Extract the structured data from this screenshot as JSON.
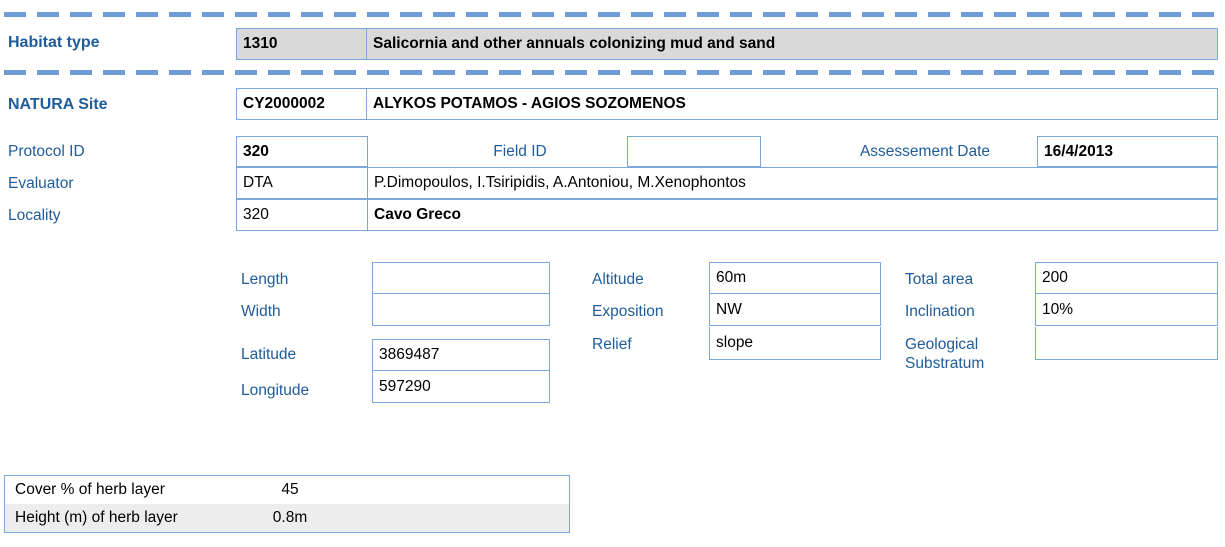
{
  "colors": {
    "accent_blue": "#7ba7d9",
    "label_blue": "#1f5c99",
    "grey_fill": "#d9d9d9",
    "alt_row": "#ededed"
  },
  "habitat": {
    "label": "Habitat type",
    "code": "1310",
    "name": "Salicornia and other annuals colonizing mud and sand"
  },
  "natura": {
    "label": "NATURA Site",
    "code": "CY2000002",
    "name": "ALYKOS POTAMOS - AGIOS SOZOMENOS"
  },
  "protocol": {
    "label": "Protocol ID",
    "value": "320",
    "field_id_label": "Field ID",
    "field_id_value": "",
    "assessment_date_label": "Assessement Date",
    "assessment_date_value": "16/4/2013"
  },
  "evaluator": {
    "label": "Evaluator",
    "code": "DTA",
    "names": "P.Dimopoulos, I.Tsiripidis, A.Antoniou, M.Xenophontos"
  },
  "locality": {
    "label": "Locality",
    "code": "320",
    "name": "Cavo Greco"
  },
  "measurements": {
    "length": {
      "label": "Length",
      "value": ""
    },
    "width": {
      "label": "Width",
      "value": ""
    },
    "latitude": {
      "label": "Latitude",
      "value": "3869487"
    },
    "longitude": {
      "label": "Longitude",
      "value": "597290"
    },
    "altitude": {
      "label": "Altitude",
      "value": "60m"
    },
    "exposition": {
      "label": "Exposition",
      "value": "NW"
    },
    "relief": {
      "label": "Relief",
      "value": "slope"
    },
    "total_area": {
      "label": "Total area",
      "value": "200"
    },
    "inclination": {
      "label": "Inclination",
      "value": "10%"
    },
    "geological_substratum": {
      "label_line1": "Geological",
      "label_line2": "Substratum",
      "value": ""
    }
  },
  "summary": {
    "rows": [
      {
        "key": "Cover % of herb layer",
        "value": "45"
      },
      {
        "key": "Height (m) of herb layer",
        "value": "0.8m"
      }
    ]
  }
}
